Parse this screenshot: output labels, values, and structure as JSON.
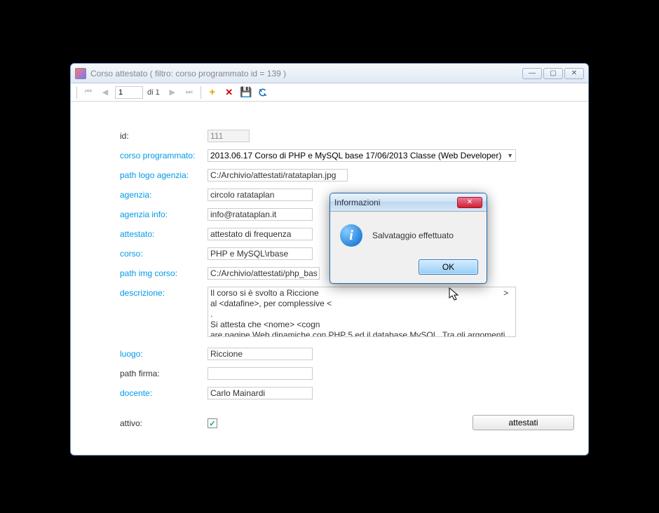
{
  "window": {
    "title": "Corso attestato ( filtro: corso programmato id = 139 )"
  },
  "navigator": {
    "position": "1",
    "of_label": "di 1"
  },
  "form": {
    "id": {
      "label": "id:",
      "value": "111"
    },
    "corso_programmato": {
      "label": "corso programmato:",
      "value": "2013.06.17 Corso di PHP e MySQL base 17/06/2013 Classe (Web Developer)"
    },
    "path_logo": {
      "label": "path logo agenzia:",
      "value": "C:/Archivio/attestati/ratataplan.jpg"
    },
    "agenzia": {
      "label": "agenzia:",
      "value": "circolo ratataplan"
    },
    "agenzia_info": {
      "label": "agenzia info:",
      "value": "info@ratataplan.it"
    },
    "attestato": {
      "label": "attestato:",
      "value": "attestato di frequenza"
    },
    "corso": {
      "label": "corso:",
      "value": "PHP e MySQL\\rbase"
    },
    "path_img_corso": {
      "label": "path img corso:",
      "value": "C:/Archivio/attestati/php_bas"
    },
    "descrizione": {
      "label": "descrizione:",
      "value": "Il corso si è svolto a Riccione                                                                               > al <datafine>, per complessive <                                                                                    .\nSi attesta che <nome> <cogn                                                                                     are pagine Web dinamiche con PHP 5 ed il database MySQL. Tra gli argomenti trattati: gli array e le funzioni, la creazione e l'elaborazione di moduli Web, lettura, scrittura e modifica dati con il"
    },
    "luogo": {
      "label": "luogo:",
      "value": "Riccione"
    },
    "path_firma": {
      "label": "path firma:",
      "value": ""
    },
    "docente": {
      "label": "docente:",
      "value": "Carlo Mainardi"
    },
    "attivo": {
      "label": "attivo:",
      "checked": "✓"
    },
    "attestati_btn": "attestati"
  },
  "dialog": {
    "title": "Informazioni",
    "message": "Salvataggio effettuato",
    "ok": "OK"
  }
}
